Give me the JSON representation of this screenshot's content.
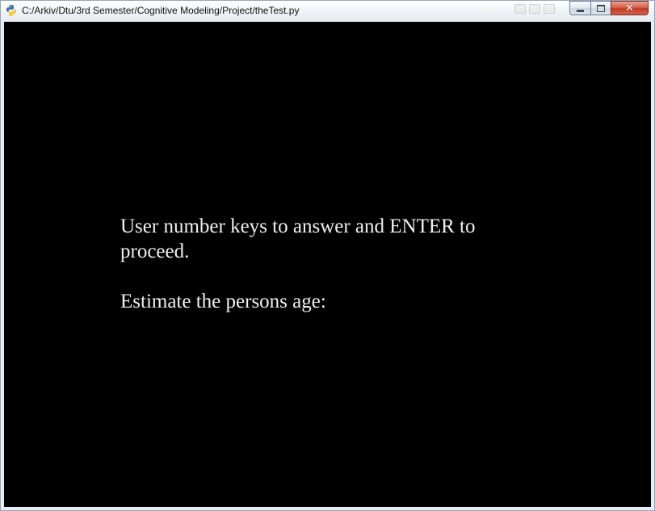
{
  "window": {
    "title": "C:/Arkiv/Dtu/3rd Semester/Cognitive Modeling/Project/theTest.py",
    "app_icon": "python-icon",
    "controls": {
      "minimize_icon": "minimize-icon",
      "maximize_icon": "maximize-icon",
      "close_icon": "close-icon",
      "close_glyph": "✕"
    }
  },
  "content": {
    "background_color": "#000000",
    "text_color": "#f0f0f0",
    "instruction": "User number keys to answer and ENTER to proceed.",
    "prompt": "Estimate the persons age:"
  },
  "colors": {
    "close_button": "#c13a24",
    "title_text": "#111111"
  }
}
